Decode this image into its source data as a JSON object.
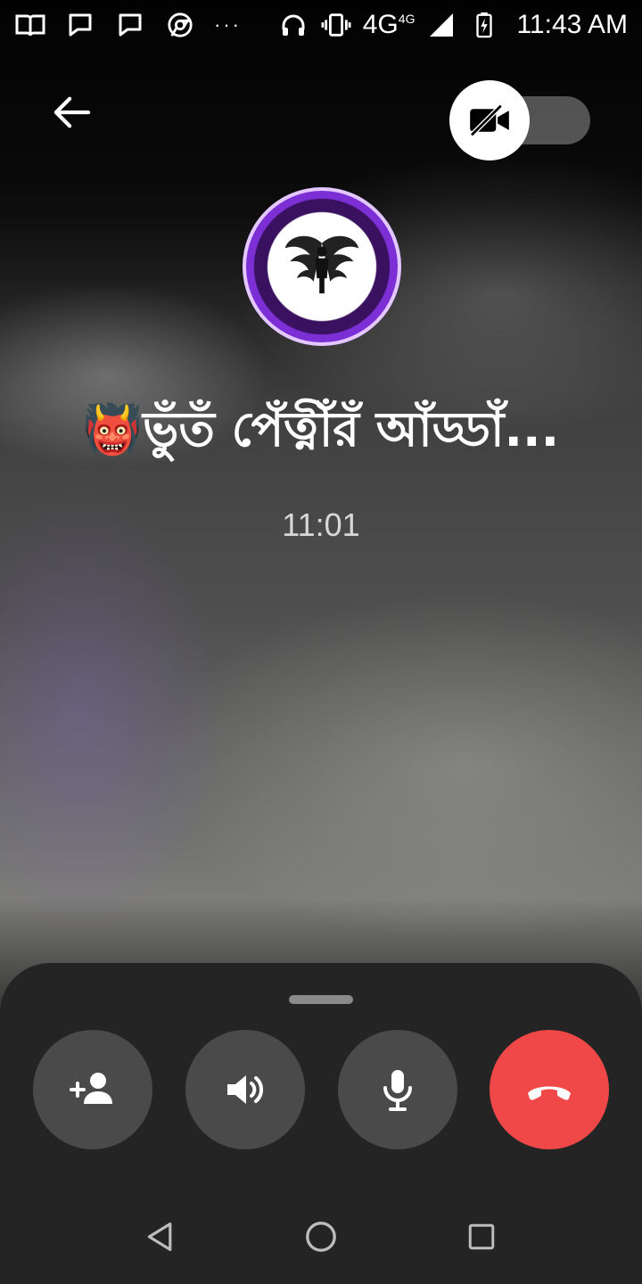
{
  "status_bar": {
    "icons": [
      "book-icon",
      "chat-bubble-icon",
      "chat-bubble-icon",
      "chrome-icon",
      "headphones-icon",
      "vibrate-icon",
      "signal-icon",
      "battery-charging-icon"
    ],
    "overflow": "···",
    "network": "4G",
    "network_sup": "4G",
    "time": "11:43 AM"
  },
  "call": {
    "caller_name": "👹ভুঁতঁ পেঁত্নীঁরঁ আঁড্ডাঁ...",
    "duration": "11:01",
    "video_enabled": false
  },
  "controls": {
    "buttons": [
      "add-person-icon",
      "speaker-icon",
      "microphone-icon",
      "end-call-icon"
    ],
    "end_call_color": "#F04848"
  },
  "nav": {
    "buttons": [
      "back-triangle-icon",
      "home-circle-icon",
      "recents-square-icon"
    ]
  }
}
